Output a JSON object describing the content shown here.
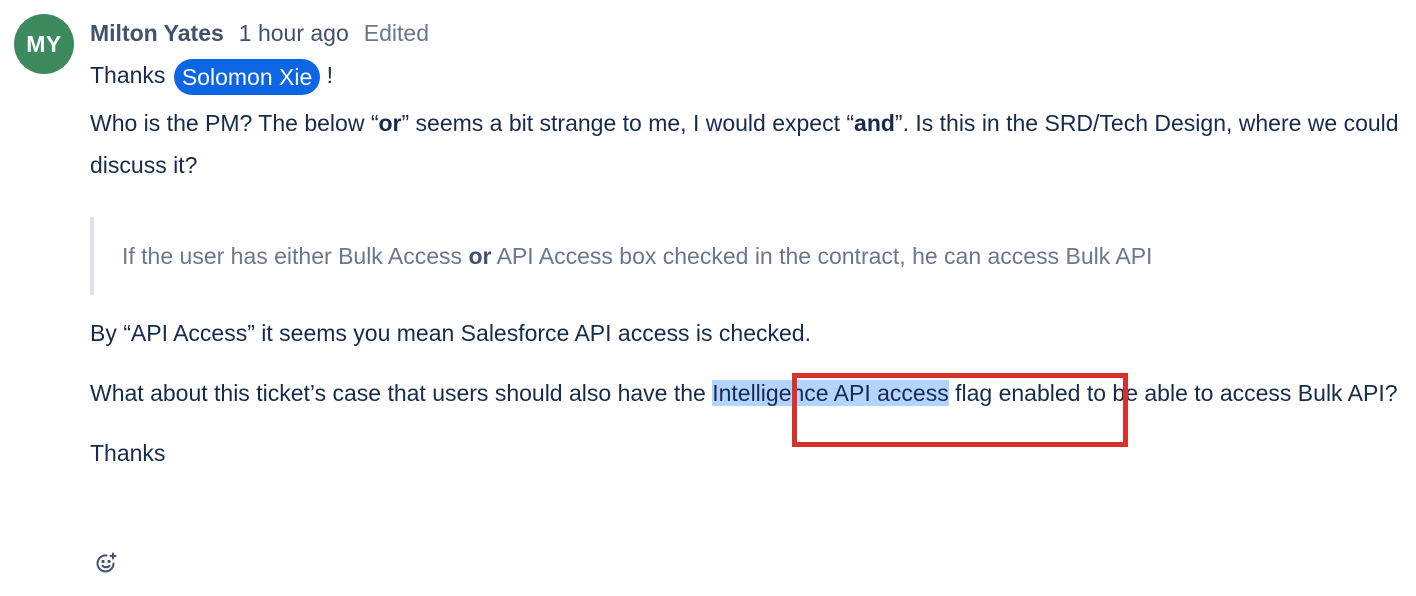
{
  "comment": {
    "avatar_initials": "MY",
    "avatar_color": "#3c8a5e",
    "author": "Milton Yates",
    "time": "1 hour ago",
    "edited": "Edited",
    "thanks_prefix": "Thanks",
    "mention": "Solomon Xie",
    "thanks_suffix": " !",
    "p2_a": "Who is the PM? The below “",
    "p2_b": "or",
    "p2_c": "” seems a bit strange to me, I would expect “",
    "p2_d": "and",
    "p2_e": "”. Is this in the SRD/Tech Design, where we could discuss it?",
    "quote_a": "If the user has either Bulk Access ",
    "quote_b": "or",
    "quote_c": " API Access box checked in the contract, he can access Bulk API",
    "p3": "By “API Access” it seems you mean Salesforce API access is checked.",
    "p4_a": "What about this ticket’s case that users should also have the ",
    "p4_highlight": "Intelligence API access",
    "p4_b": " flag enabled to be able to access Bulk API?",
    "closing": "Thanks",
    "reaction_icon": "add-reaction-icon"
  },
  "colors": {
    "mention_bg": "#0c66e4",
    "highlight": "#b3d4ff",
    "annotation_box": "#d9302c"
  }
}
